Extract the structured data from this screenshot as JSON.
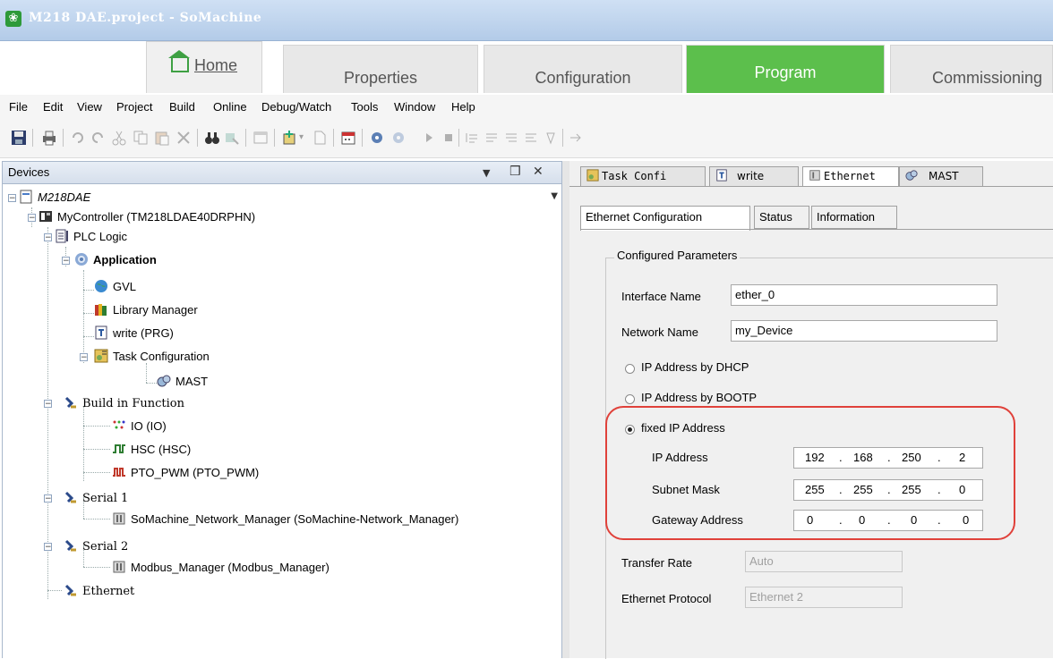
{
  "window": {
    "title": "M218 DAE.project - SoMachine"
  },
  "ribbon": {
    "tabs": [
      {
        "label": "Home"
      },
      {
        "label": "Properties"
      },
      {
        "label": "Configuration"
      },
      {
        "label": "Program"
      },
      {
        "label": "Commissioning"
      }
    ],
    "active_tab": "Program",
    "active_color": "#5cbf4c"
  },
  "menu": [
    "File",
    "Edit",
    "View",
    "Project",
    "Build",
    "Online",
    "Debug/Watch",
    "Tools",
    "Window",
    "Help"
  ],
  "devices": {
    "title": "Devices",
    "pin_glyph": "❒",
    "close_glyph": "✕",
    "tree": [
      {
        "label": "M218DAE",
        "icon": "project-icon"
      },
      {
        "label": "MyController (TM218LDAE40DRPHN)",
        "icon": "controller-icon"
      },
      {
        "label": "PLC Logic",
        "icon": "plc-logic-icon"
      },
      {
        "label": "Application",
        "icon": "application-gear-icon"
      },
      {
        "label": "GVL",
        "icon": "globe-icon"
      },
      {
        "label": "Library Manager",
        "icon": "library-books-icon"
      },
      {
        "label": "write (PRG)",
        "icon": "program-icon"
      },
      {
        "label": "Task Configuration",
        "icon": "task-config-icon"
      },
      {
        "label": "MAST",
        "icon": "task-icon"
      },
      {
        "label": "Build in Function",
        "icon": "function-icon"
      },
      {
        "label": "IO (IO)",
        "icon": "io-icon"
      },
      {
        "label": "HSC (HSC)",
        "icon": "hsc-icon"
      },
      {
        "label": "PTO_PWM (PTO_PWM)",
        "icon": "pto-icon"
      },
      {
        "label": "Serial 1",
        "icon": "serial-icon"
      },
      {
        "label": "SoMachine_Network_Manager (SoMachine-Network_Manager)",
        "icon": "network-manager-icon"
      },
      {
        "label": "Serial 2",
        "icon": "serial-icon"
      },
      {
        "label": "Modbus_Manager (Modbus_Manager)",
        "icon": "network-manager-icon"
      },
      {
        "label": "Ethernet",
        "icon": "ethernet-icon"
      }
    ]
  },
  "doc_tabs": [
    {
      "label": "Task Confi"
    },
    {
      "label": "write"
    },
    {
      "label": "Ethernet"
    },
    {
      "label": "MAST"
    }
  ],
  "sub_tabs": [
    {
      "label": "Ethernet Configuration"
    },
    {
      "label": "Status"
    },
    {
      "label": "Information"
    }
  ],
  "ethernet": {
    "group_title": "Configured Parameters",
    "interface_name": {
      "label": "Interface Name",
      "value": "ether_0"
    },
    "network_name": {
      "label": "Network Name",
      "value": "my_Device"
    },
    "radio_dhcp": "IP Address by DHCP",
    "radio_bootp": "IP Address by BOOTP",
    "radio_fixed": "fixed IP Address",
    "selected_mode": "fixed IP Address",
    "ip_address": {
      "label": "IP Address",
      "octets": [
        "192",
        "168",
        "250",
        "2"
      ]
    },
    "subnet_mask": {
      "label": "Subnet Mask",
      "octets": [
        "255",
        "255",
        "255",
        "0"
      ]
    },
    "gateway": {
      "label": "Gateway Address",
      "octets": [
        "0",
        "0",
        "0",
        "0"
      ]
    },
    "dot": ".",
    "transfer_rate": {
      "label": "Transfer Rate",
      "value": "Auto"
    },
    "protocol": {
      "label": "Ethernet Protocol",
      "value": "Ethernet 2"
    },
    "highlight_color": "#e0413a"
  }
}
